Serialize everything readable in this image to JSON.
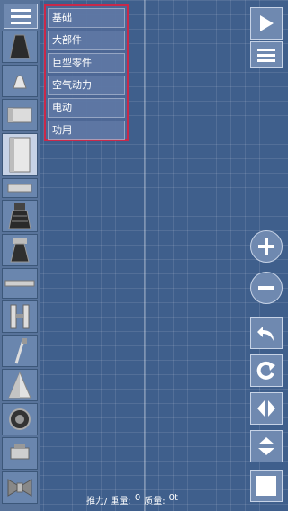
{
  "categories": [
    "基础",
    "大部件",
    "巨型零件",
    "空气动力",
    "电动",
    "功用"
  ],
  "parts": [
    {
      "name": "nose-cone-dark-icon",
      "selected": false
    },
    {
      "name": "capsule-icon",
      "selected": false
    },
    {
      "name": "fuel-tank-short-icon",
      "selected": false
    },
    {
      "name": "fuel-tank-tall-icon",
      "selected": true
    },
    {
      "name": "separator-icon",
      "selected": false
    },
    {
      "name": "engine-large-icon",
      "selected": false
    },
    {
      "name": "engine-small-icon",
      "selected": false
    },
    {
      "name": "decoupler-icon",
      "selected": false
    },
    {
      "name": "side-booster-icon",
      "selected": false
    },
    {
      "name": "landing-leg-icon",
      "selected": false
    },
    {
      "name": "fairing-cone-icon",
      "selected": false
    },
    {
      "name": "wheel-icon",
      "selected": false
    },
    {
      "name": "docking-port-icon",
      "selected": false
    },
    {
      "name": "solar-panel-icon",
      "selected": false
    }
  ],
  "stats": {
    "thrust_label": "推力/ 重量:",
    "thrust_value": "0",
    "mass_label": "质量:",
    "mass_value": "0t"
  },
  "colors": {
    "background": "#3f5f8c",
    "menu_border": "#c8294a",
    "button": "#6f89b0"
  }
}
